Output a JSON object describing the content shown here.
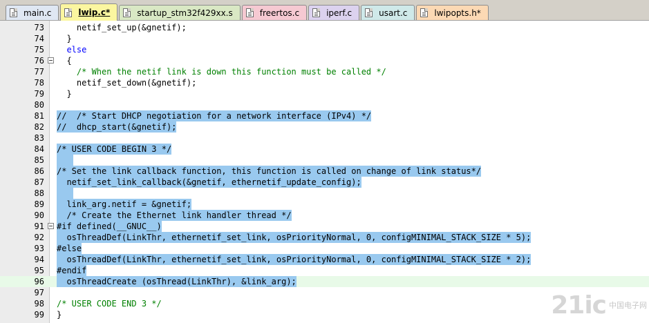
{
  "tabs": [
    {
      "label": "main.c",
      "color": "#dfe7f3",
      "active": false
    },
    {
      "label": "lwip.c*",
      "color": "#fbf6a0",
      "active": true
    },
    {
      "label": "startup_stm32f429xx.s",
      "color": "#d9e8c4",
      "active": false
    },
    {
      "label": "freertos.c",
      "color": "#f6c9d2",
      "active": false
    },
    {
      "label": "iperf.c",
      "color": "#dcd2ef",
      "active": false
    },
    {
      "label": "usart.c",
      "color": "#cfe9e9",
      "active": false
    },
    {
      "label": "lwipopts.h*",
      "color": "#fcd9b4",
      "active": false
    }
  ],
  "editor": {
    "current_line": 96,
    "lines": [
      {
        "n": "73",
        "text": "    netif_set_up(&gnetif);",
        "sel": false,
        "fold": false,
        "type": "code"
      },
      {
        "n": "74",
        "text": "  }",
        "sel": false,
        "fold": false,
        "type": "code"
      },
      {
        "n": "75",
        "text": "  else",
        "sel": false,
        "fold": false,
        "type": "kw"
      },
      {
        "n": "76",
        "text": "  {",
        "sel": false,
        "fold": true,
        "type": "code"
      },
      {
        "n": "77",
        "text": "    /* When the netif link is down this function must be called */",
        "sel": false,
        "fold": false,
        "type": "comment"
      },
      {
        "n": "78",
        "text": "    netif_set_down(&gnetif);",
        "sel": false,
        "fold": false,
        "type": "code"
      },
      {
        "n": "79",
        "text": "  }",
        "sel": false,
        "fold": false,
        "type": "code"
      },
      {
        "n": "80",
        "text": "",
        "sel": false,
        "fold": false,
        "type": "code"
      },
      {
        "n": "81",
        "text": "//  /* Start DHCP negotiation for a network interface (IPv4) */",
        "sel": true,
        "fold": false,
        "type": "code"
      },
      {
        "n": "82",
        "text": "//  dhcp_start(&gnetif);",
        "sel": true,
        "fold": false,
        "type": "code"
      },
      {
        "n": "83",
        "text": "",
        "sel": false,
        "fold": false,
        "type": "code"
      },
      {
        "n": "84",
        "text": "/* USER CODE BEGIN 3 */",
        "sel": true,
        "fold": false,
        "type": "code"
      },
      {
        "n": "85",
        "text": "",
        "sel": true,
        "fold": false,
        "type": "code"
      },
      {
        "n": "86",
        "text": "/* Set the link callback function, this function is called on change of link status*/",
        "sel": true,
        "fold": false,
        "type": "code"
      },
      {
        "n": "87",
        "text": "  netif_set_link_callback(&gnetif, ethernetif_update_config);",
        "sel": true,
        "fold": false,
        "type": "code"
      },
      {
        "n": "88",
        "text": "",
        "sel": true,
        "fold": false,
        "type": "code"
      },
      {
        "n": "89",
        "text": "  link_arg.netif = &gnetif;",
        "sel": true,
        "fold": false,
        "type": "code"
      },
      {
        "n": "90",
        "text": "  /* Create the Ethernet link handler thread */",
        "sel": true,
        "fold": false,
        "type": "code"
      },
      {
        "n": "91",
        "text": "#if defined(__GNUC__)",
        "sel": true,
        "fold": true,
        "type": "code"
      },
      {
        "n": "92",
        "text": "  osThreadDef(LinkThr, ethernetif_set_link, osPriorityNormal, 0, configMINIMAL_STACK_SIZE * 5);",
        "sel": true,
        "fold": false,
        "type": "code"
      },
      {
        "n": "93",
        "text": "#else",
        "sel": true,
        "fold": false,
        "type": "code"
      },
      {
        "n": "94",
        "text": "  osThreadDef(LinkThr, ethernetif_set_link, osPriorityNormal, 0, configMINIMAL_STACK_SIZE * 2);",
        "sel": true,
        "fold": false,
        "type": "code"
      },
      {
        "n": "95",
        "text": "#endif",
        "sel": true,
        "fold": false,
        "type": "code"
      },
      {
        "n": "96",
        "text": "  osThreadCreate (osThread(LinkThr), &link_arg);",
        "sel": true,
        "fold": false,
        "type": "code"
      },
      {
        "n": "97",
        "text": "",
        "sel": false,
        "fold": false,
        "type": "code"
      },
      {
        "n": "98",
        "text": "/* USER CODE END 3 */",
        "sel": false,
        "fold": false,
        "type": "comment"
      },
      {
        "n": "99",
        "text": "}",
        "sel": false,
        "fold": false,
        "type": "code"
      }
    ]
  },
  "watermark": {
    "big": "21ic",
    "small": "中国电子网"
  }
}
